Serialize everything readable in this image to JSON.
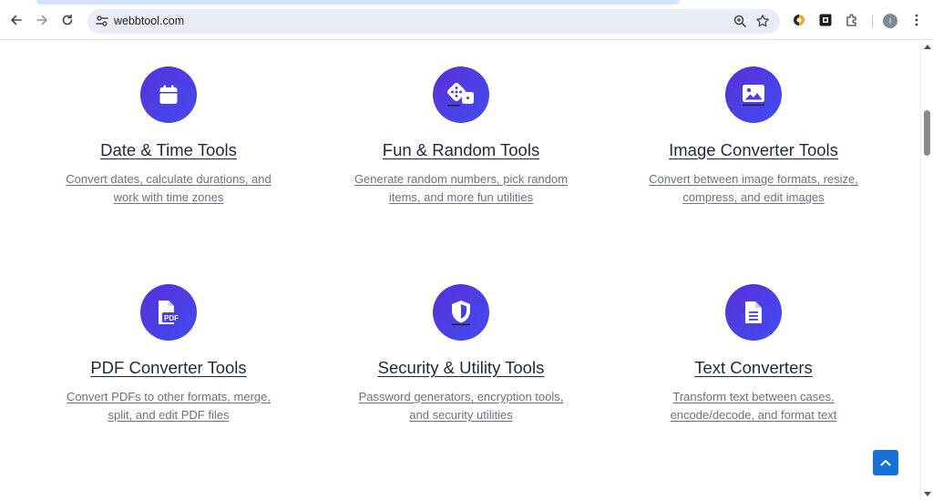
{
  "browser": {
    "url": "webbtool.com",
    "profile_initial": "I"
  },
  "colors": {
    "icon_gradient_start": "#5b2fd9",
    "icon_gradient_end": "#3f4df1",
    "scroll_top_button": "#1671d9"
  },
  "cards": [
    {
      "icon": "calendar-icon",
      "title": "Date & Time Tools",
      "description": "Convert dates, calculate durations, and work with time zones"
    },
    {
      "icon": "dice-icon",
      "title": "Fun & Random Tools",
      "description": "Generate random numbers, pick random items, and more fun utilities"
    },
    {
      "icon": "image-icon",
      "title": "Image Converter Tools",
      "description": "Convert between image formats, resize, compress, and edit images"
    },
    {
      "icon": "pdf-file-icon",
      "title": "PDF Converter Tools",
      "description": "Convert PDFs to other formats, merge, split, and edit PDF files"
    },
    {
      "icon": "shield-icon",
      "title": "Security & Utility Tools",
      "description": "Password generators, encryption tools, and security utilities"
    },
    {
      "icon": "document-icon",
      "title": "Text Converters",
      "description": "Transform text between cases, encode/decode, and format text"
    }
  ],
  "pdf_icon_label": "PDF"
}
